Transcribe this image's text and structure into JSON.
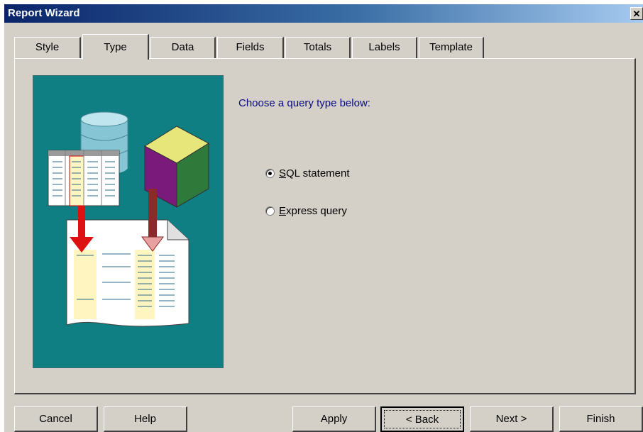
{
  "window": {
    "title": "Report Wizard",
    "close_glyph": "✕"
  },
  "tabs": [
    {
      "label": "Style",
      "active": false
    },
    {
      "label": "Type",
      "active": true
    },
    {
      "label": "Data",
      "active": false
    },
    {
      "label": "Fields",
      "active": false
    },
    {
      "label": "Totals",
      "active": false
    },
    {
      "label": "Labels",
      "active": false
    },
    {
      "label": "Template",
      "active": false
    }
  ],
  "main": {
    "prompt": "Choose a query type below:",
    "options": [
      {
        "mnemonic": "S",
        "rest": "QL statement",
        "selected": true
      },
      {
        "mnemonic": "E",
        "rest": "xpress query",
        "selected": false
      }
    ],
    "illustration_bg": "#0f7f84"
  },
  "buttons": {
    "cancel": "Cancel",
    "help": "Help",
    "apply": "Apply",
    "back": "< Back",
    "next": "Next >",
    "finish": "Finish"
  },
  "colors": {
    "title_bar": "#0a246a",
    "dialog_bg": "#d4d0c8",
    "prompt_text": "#0a0a84"
  }
}
